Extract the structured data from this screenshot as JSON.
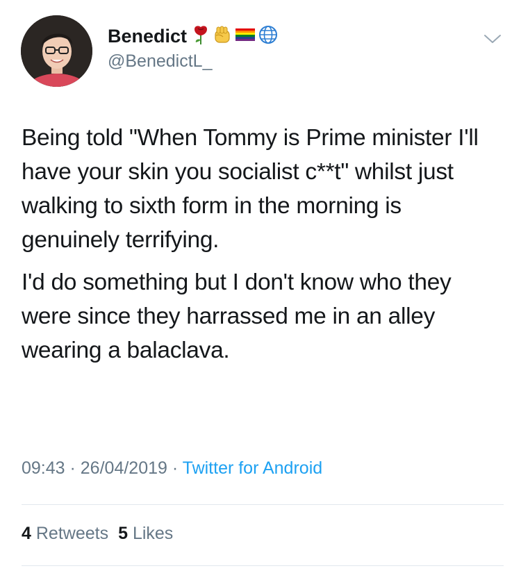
{
  "user": {
    "display_name": "Benedict",
    "handle": "@BenedictL_",
    "emojis": [
      "rose-emoji",
      "raised-fist-emoji",
      "rainbow-flag-emoji",
      "globe-icon"
    ]
  },
  "tweet": {
    "paragraphs": [
      "Being told \"When Tommy is Prime minister I'll have your skin you socialist c**t\" whilst just walking to sixth form in the morning is genuinely terrifying.",
      "I'd do something but I don't know who they were since they harrassed me in an alley wearing a balaclava."
    ],
    "time": "09:43",
    "date": "26/04/2019",
    "source": "Twitter for Android",
    "separator": " · "
  },
  "stats": {
    "retweets_count": "4",
    "retweets_label": "Retweets",
    "likes_count": "5",
    "likes_label": "Likes"
  },
  "colors": {
    "text": "#14171a",
    "secondary": "#657786",
    "link": "#1da1f2",
    "divider": "#e1e8ed"
  }
}
